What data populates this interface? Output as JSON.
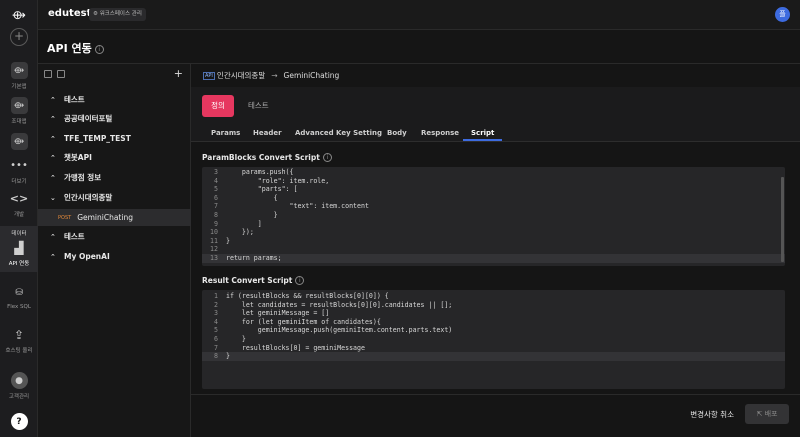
{
  "app": {
    "title": "edutest",
    "workspace_btn": "워크스페이스 관리",
    "avatar": "플",
    "logo": "⟴"
  },
  "rail": [
    {
      "label": "기본앱",
      "icon": "link-icon"
    },
    {
      "label": "조대앱",
      "icon": "link-icon"
    },
    {
      "label": "",
      "icon": "link-icon"
    },
    {
      "label": "더보기",
      "icon": "more-icon"
    },
    {
      "label": "개발",
      "icon": "code-icon"
    },
    {
      "label": "데이터",
      "icon": "data-icon"
    },
    {
      "label": "API 연동",
      "icon": "factory-icon"
    },
    {
      "label": "Flex SQL",
      "icon": "sql-icon"
    },
    {
      "label": "호스팅 올리",
      "icon": "upload-icon"
    },
    {
      "label": "고객관리",
      "icon": "user-icon"
    },
    {
      "label": "?",
      "icon": "help-icon"
    }
  ],
  "page": {
    "title": "API 연동"
  },
  "tree": {
    "items": [
      {
        "label": "테스트"
      },
      {
        "label": "공공데이터포털"
      },
      {
        "label": "TFE_TEMP_TEST"
      },
      {
        "label": "챗봇API"
      },
      {
        "label": "가맹점 정보"
      },
      {
        "label": "인간시대의종말"
      },
      {
        "label": "테스트"
      },
      {
        "label": "My OpenAI"
      }
    ],
    "sub": {
      "method": "POST",
      "label": "GeminiChating"
    }
  },
  "breadcrumb": {
    "badge": "API",
    "parent": "인간시대의종말",
    "sep": "→",
    "current": "GeminiChating"
  },
  "mode_tabs": {
    "active": "정의",
    "other": "테스트"
  },
  "sub_tabs": [
    "Params",
    "Header",
    "Advanced Key Setting",
    "Body",
    "Response",
    "Script"
  ],
  "sub_tabs_active": "Script",
  "param_script": {
    "title": "ParamBlocks Convert Script",
    "lines": [
      {
        "n": "3",
        "t": "    params.push({"
      },
      {
        "n": "4",
        "t": "        \"role\": item.role,"
      },
      {
        "n": "5",
        "t": "        \"parts\": ["
      },
      {
        "n": "6",
        "t": "            {"
      },
      {
        "n": "7",
        "t": "                \"text\": item.content"
      },
      {
        "n": "8",
        "t": "            }"
      },
      {
        "n": "9",
        "t": "        ]"
      },
      {
        "n": "10",
        "t": "    });"
      },
      {
        "n": "11",
        "t": "}"
      },
      {
        "n": "12",
        "t": ""
      },
      {
        "n": "13",
        "t": "return params;"
      }
    ]
  },
  "result_script": {
    "title": "Result Convert Script",
    "lines": [
      {
        "n": "1",
        "t": "if (resultBlocks && resultBlocks[0][0]) {"
      },
      {
        "n": "2",
        "t": "    let candidates = resultBlocks[0][0].candidates || [];"
      },
      {
        "n": "3",
        "t": "    let geminiMessage = []"
      },
      {
        "n": "4",
        "t": "    for (let geminiItem of candidates){"
      },
      {
        "n": "5",
        "t": "        geminiMessage.push(geminiItem.content.parts.text)"
      },
      {
        "n": "6",
        "t": "    }"
      },
      {
        "n": "7",
        "t": "    resultBlocks[0] = geminiMessage"
      },
      {
        "n": "8",
        "t": "}"
      }
    ]
  },
  "footer": {
    "discard": "변경사항 취소",
    "deploy": "배포"
  },
  "colors": {
    "accent": "#e6375f",
    "brand_blue": "#3d6bdf",
    "method_post": "#e58a3a"
  }
}
